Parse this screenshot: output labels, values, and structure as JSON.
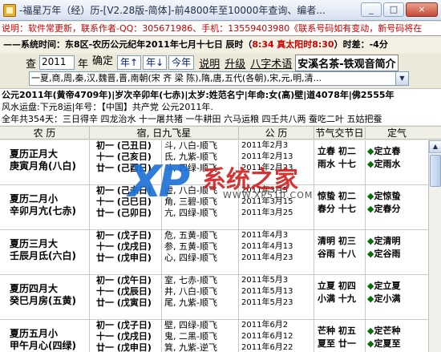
{
  "window": {
    "title": "-福星万年（经）历-[V2.28版-简体]-前4800年至10000年查询、编者...",
    "minimize": "_",
    "maximize": "□",
    "close": "×"
  },
  "notice": "说明：软件常更新，联系作者-QQ：305671986、手机：13559403980《联系号码如有变动，新号码将在",
  "sysbar": {
    "label": "——系统时间：东8区-农历公元纪年2011年七月十七日",
    "chen_label": "辰时（",
    "time1": "8:34",
    "solar_label": "真太阳时",
    "time2": "8:30",
    "tail": "）时差：-4分"
  },
  "query": {
    "prefix": "查",
    "year_value": "2011",
    "year_unit": "年",
    "confirm_label": "确定",
    "year_up": "年↑",
    "year_down": "年↓",
    "this_year": "今年",
    "help": "说明",
    "upgrade": "升级",
    "bazi": "八字术语",
    "ad": "安溪名茶-铁观音简介"
  },
  "dynasty": "一夏,商,周,秦,汉,魏晋,晋,南朝(宋 齐 梁 陈),隋,唐,五代(各朝),宋,元,明,清...",
  "yearinfo": {
    "line1": "公元2011年(黄帝4709年)|岁次辛卯年(七赤)|太岁:姓范名宁|年命:女(高)壁|道4078年|佛2555年",
    "line2": "风水运盘:下元8运|年号：【中国】共产党 公元2011年.",
    "line3": "全年共354天：三日得辛 四龙治水 十一屠共猪 一牛耕田 六马运粮 四壬共八两 蚕吃二叶 五姑把蚕"
  },
  "table": {
    "headers": [
      "农 历",
      "宿, 日九飞星",
      "公 历",
      "节气交节日",
      "定气"
    ],
    "rows": [
      {
        "month": "夏历正月大",
        "ganzhi_month": "庚寅月角(八白)",
        "days": [
          "初一 (己丑日)",
          "十一 (己亥日)",
          "廿一 (己酉日)"
        ],
        "stars": [
          "斗, 八白-顺飞",
          "氐, 九紫-顺飞",
          "斗, 四绿-顺飞"
        ],
        "solar": [
          "2011年2月3",
          "2011年2月13",
          "2011年2月23"
        ],
        "terms": [
          "立春  初二",
          "雨水  十七"
        ],
        "defs": [
          "定立春",
          "定雨水"
        ]
      },
      {
        "month": "夏历二月小",
        "ganzhi_month": "辛卯月亢(七赤)",
        "days": [
          "初一 (己未日)",
          "十一 (己巳日)",
          "廿一 (己卯日)"
        ],
        "stars": [
          "虚, 八白-顺飞",
          "角, 三碧-顺飞",
          "亢, 四绿-顺飞"
        ],
        "solar": [
          "2011年3月5",
          "2011年3月15",
          "2011年3月25"
        ],
        "terms": [
          "惊蛰  初二",
          "春分  十七"
        ],
        "defs": [
          "定惊蛰",
          "定春分"
        ]
      },
      {
        "month": "夏历三月大",
        "ganzhi_month": "壬辰月氐(六白)",
        "days": [
          "初一 (戊子日)",
          "十一 (戊戌日)",
          "廿一 (戊申日)"
        ],
        "stars": [
          "危, 五黄-顺飞",
          "参, 五黄-顺飞",
          "心, 四绿-顺飞"
        ],
        "solar": [
          "2011年4月3",
          "2011年4月13",
          "2011年4月23"
        ],
        "terms": [
          "清明  初三",
          "谷雨  十八"
        ],
        "defs": [
          "定清明",
          "定谷雨"
        ]
      },
      {
        "month": "夏历四月大",
        "ganzhi_month": "癸巳月房(五黄)",
        "days": [
          "初一 (戊午日)",
          "十一 (戊辰日)",
          "廿一 (戊寅日)"
        ],
        "stars": [
          "室, 七赤-顺飞",
          "井, 八白-顺飞",
          "尾, 九紫-顺飞"
        ],
        "solar": [
          "2011年5月3",
          "2011年5月13",
          "2011年5月23"
        ],
        "terms": [
          "立夏  初四",
          "小满  十九"
        ],
        "defs": [
          "定立夏",
          "定小满"
        ]
      },
      {
        "month": "夏历五月小",
        "ganzhi_month": "甲午月心(四绿)",
        "days": [
          "初一 (戊子日)",
          "十一 (戊戌日)",
          "廿一 (戊申日)"
        ],
        "stars": [
          "壁, 四绿-顺飞",
          "鬼, 二黑-顺飞",
          "箕, 九紫-逆飞"
        ],
        "solar": [
          "2011年6月2",
          "2011年6月12",
          "2011年6月22"
        ],
        "terms": [
          "芒种  初五",
          "夏至  廿一"
        ],
        "defs": [
          "定芒种",
          "定夏至"
        ]
      }
    ]
  },
  "watermark": {
    "xp": "XP",
    "cn": "系统之家",
    "url": "WWW.XP510.COM"
  }
}
